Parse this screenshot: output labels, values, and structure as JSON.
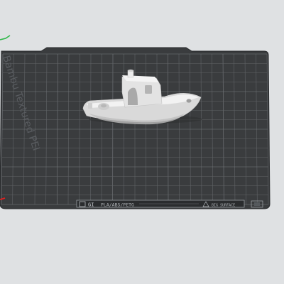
{
  "viewport": {
    "bed_side_label": "Bambu Textured PEI",
    "bed_front_plate_label": "PLA/ABS/PETG",
    "bed_front_side_label": "BIG SURFACE",
    "bed_front_mark": "GI"
  },
  "colors": {
    "background": "#dfe1e3",
    "bed_surface": "#3a3c3e",
    "grid_line": "#6b6e72",
    "model": "#e6e6e6",
    "axis_x": "#e02020",
    "axis_y": "#2fb84a"
  },
  "icons": [
    "bed-logo-icon",
    "warning-triangle-icon",
    "axis-y-icon",
    "axis-x-icon"
  ]
}
